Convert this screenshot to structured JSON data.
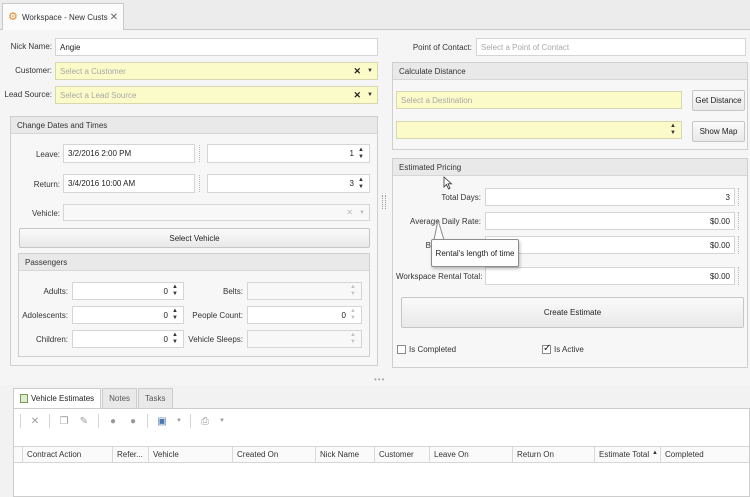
{
  "window": {
    "tab_title": "Workspace - New Custs",
    "close_glyph": "✕"
  },
  "customer": {
    "nick_name_label": "Nick Name:",
    "nick_name_value": "Angie",
    "customer_label": "Customer:",
    "customer_placeholder": "Select a Customer",
    "lead_source_label": "Lead Source:",
    "lead_source_placeholder": "Select a Lead Source"
  },
  "dates": {
    "group_title": "Change Dates and Times",
    "leave_label": "Leave:",
    "leave_value": "3/2/2016 2:00 PM",
    "leave_days": "1",
    "return_label": "Return:",
    "return_value": "3/4/2016 10:00 AM",
    "return_days": "3",
    "vehicle_label": "Vehicle:",
    "select_vehicle_button": "Select Vehicle"
  },
  "passengers": {
    "group_title": "Passengers",
    "adults_label": "Adults:",
    "adults_value": "0",
    "adolescents_label": "Adolescents:",
    "adolescents_value": "0",
    "children_label": "Children:",
    "children_value": "0",
    "belts_label": "Belts:",
    "people_count_label": "People Count:",
    "people_count_value": "0",
    "vehicle_sleeps_label": "Vehicle Sleeps:"
  },
  "contact": {
    "poc_label": "Point of Contact:",
    "poc_placeholder": "Select a Point of Contact"
  },
  "distance": {
    "group_title": "Calculate Distance",
    "destination_placeholder": "Select a Destination",
    "get_distance_button": "Get Distance",
    "show_map_button": "Show Map"
  },
  "pricing": {
    "group_title": "Estimated Pricing",
    "total_days_label": "Total Days:",
    "total_days_value": "3",
    "avg_daily_rate_label": "Average Daily Rate:",
    "avg_daily_rate_value": "$0.00",
    "row3_label_fragment": "B",
    "row3_value": "$0.00",
    "rental_total_label": "Workspace Rental Total:",
    "rental_total_value": "$0.00",
    "create_estimate_button": "Create Estimate",
    "is_completed_label": "Is Completed",
    "is_completed_checked": false,
    "is_active_label": "Is Active",
    "is_active_checked": true,
    "tooltip_text": "Rental's length of time"
  },
  "bottom": {
    "tabs": [
      "Vehicle Estimates",
      "Notes",
      "Tasks"
    ],
    "active_tab": "Vehicle Estimates",
    "columns": [
      "Contract Action",
      "Refer...",
      "Vehicle",
      "Created On",
      "Nick Name",
      "Customer",
      "Leave On",
      "Return On",
      "Estimate Total",
      "Completed"
    ],
    "sort_indicator": "▲"
  },
  "colors": {
    "required_field": "#fbfbc9",
    "panel_header": "#e9e9e9",
    "tab_icon": "#e08a2a"
  }
}
